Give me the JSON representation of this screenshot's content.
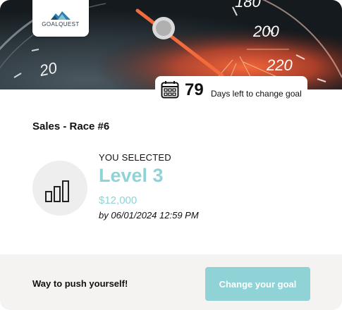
{
  "brand": {
    "logo_text": "GOALQUEST"
  },
  "hero": {
    "gauge_labels": [
      "20",
      "180",
      "200",
      "220"
    ]
  },
  "countdown": {
    "days": "79",
    "label": "Days left to change goal"
  },
  "race": {
    "title": "Sales - Race #6"
  },
  "selection": {
    "heading": "YOU SELECTED",
    "level": "Level 3",
    "amount": "$12,000",
    "deadline": "by 06/01/2024 12:59 PM"
  },
  "footer": {
    "message": "Way to push yourself!",
    "button_label": "Change your goal"
  },
  "colors": {
    "accent": "#8fd3d6",
    "footer_bg": "#f4f3f2",
    "icon_circle": "#eeeeee"
  },
  "icons": {
    "calendar": "calendar-icon",
    "level": "bar-chart-icon",
    "logo": "mountain-logo-icon"
  }
}
